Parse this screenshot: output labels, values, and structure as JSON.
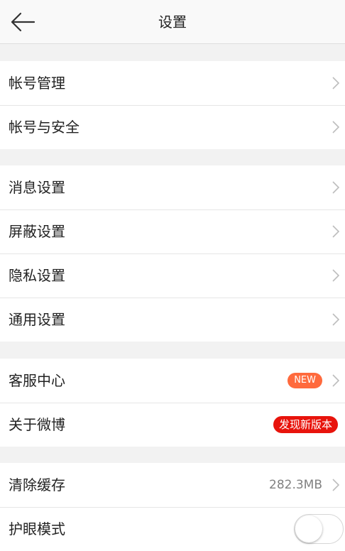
{
  "header": {
    "title": "设置",
    "back_icon": "back-arrow-icon"
  },
  "groups": [
    {
      "items": [
        {
          "label": "帐号管理"
        },
        {
          "label": "帐号与安全"
        }
      ]
    },
    {
      "items": [
        {
          "label": "消息设置"
        },
        {
          "label": "屏蔽设置"
        },
        {
          "label": "隐私设置"
        },
        {
          "label": "通用设置"
        }
      ]
    },
    {
      "items": [
        {
          "label": "客服中心",
          "badge": "NEW"
        },
        {
          "label": "关于微博",
          "badge": "发现新版本"
        }
      ]
    },
    {
      "items": [
        {
          "label": "清除缓存",
          "value": "282.3MB"
        },
        {
          "label": "护眼模式",
          "toggle_on": false
        }
      ]
    }
  ],
  "colors": {
    "new_badge": "#ff6a3d",
    "update_badge": "#e8140c",
    "background": "#f2f2f2"
  }
}
